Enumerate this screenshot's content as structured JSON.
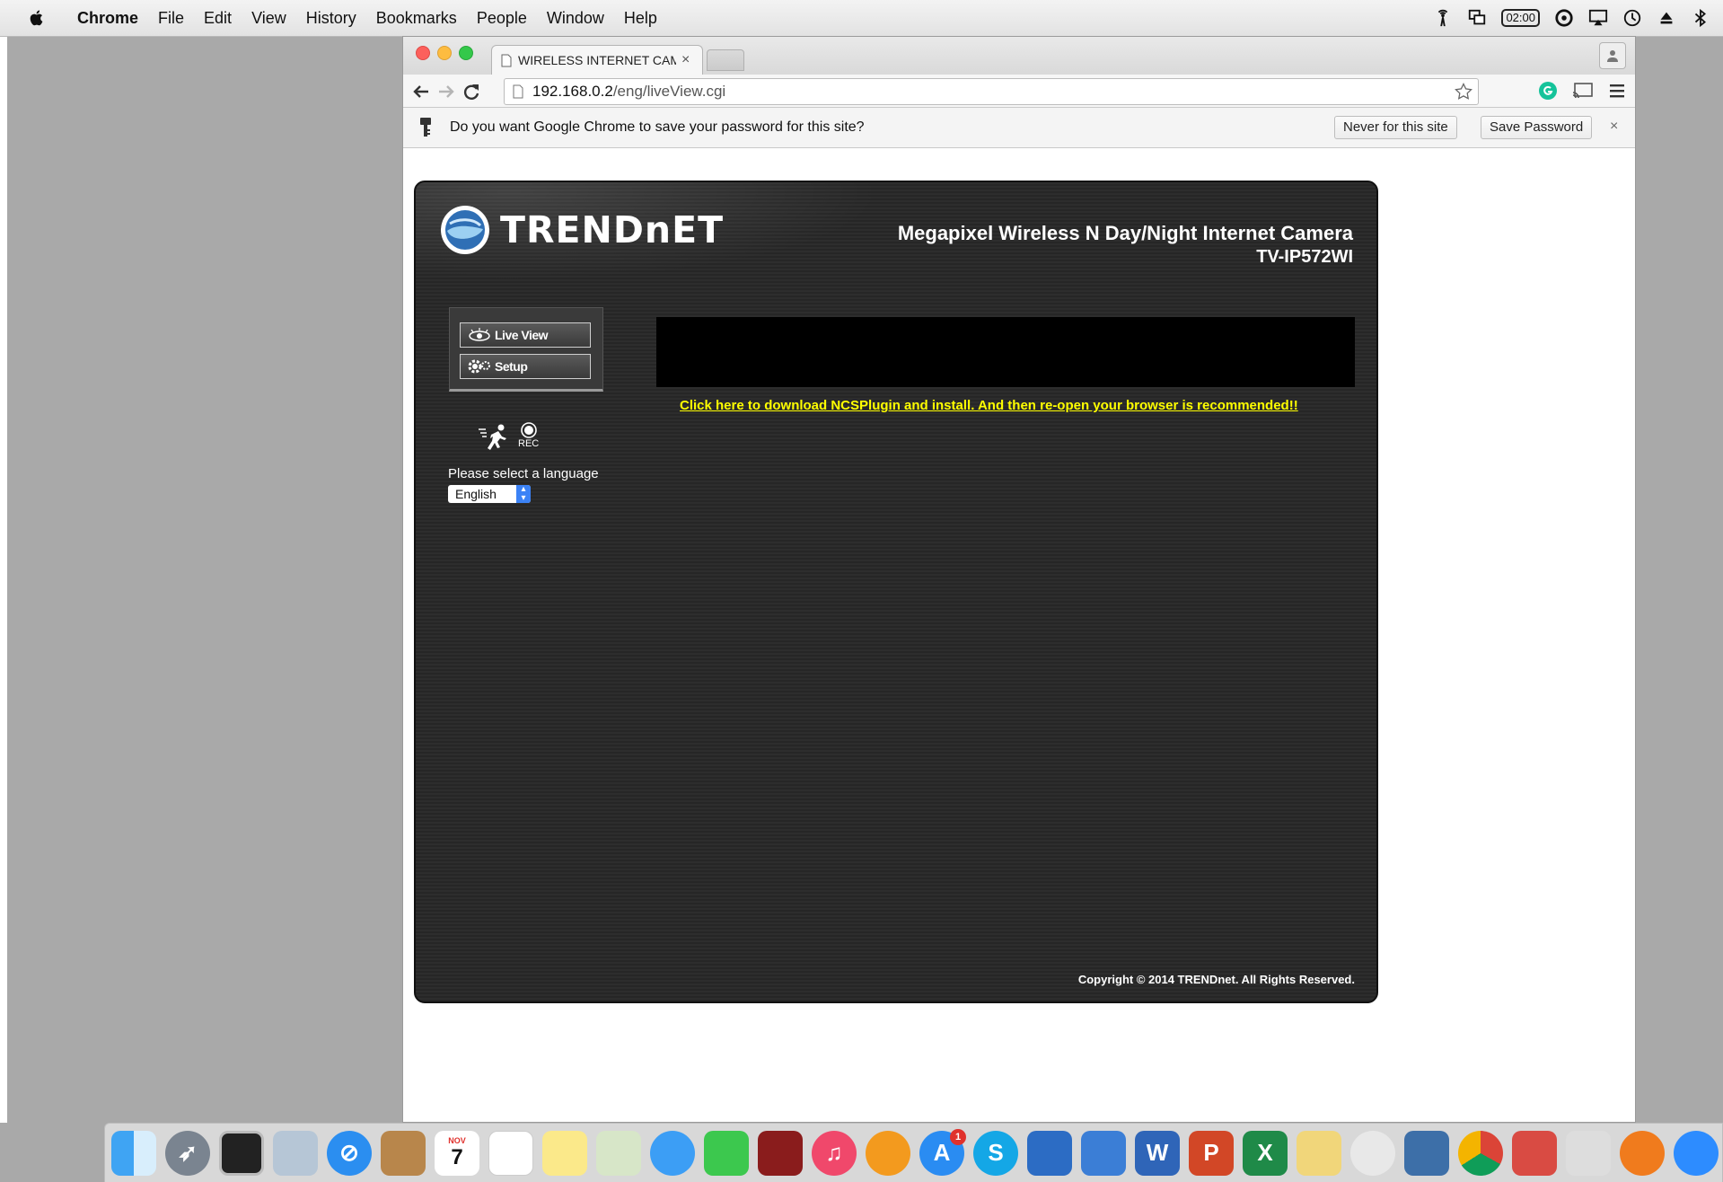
{
  "menubar": {
    "items": [
      "Chrome",
      "File",
      "Edit",
      "View",
      "History",
      "Bookmarks",
      "People",
      "Window",
      "Help"
    ],
    "clock": "02:00"
  },
  "browser": {
    "tab_title": "WIRELESS INTERNET CAMERA",
    "tab_close": "×",
    "url_host": "192.168.0.2",
    "url_path": "/eng/liveView.cgi",
    "infobar": {
      "message": "Do you want Google Chrome to save your password for this site?",
      "never_label": "Never for this site",
      "save_label": "Save Password",
      "close": "×"
    }
  },
  "camera": {
    "brand": "TRENDnET",
    "title": "Megapixel Wireless N Day/Night Internet Camera",
    "model": "TV-IP572WI",
    "nav": [
      {
        "label": "Live View",
        "icon": "eye-icon"
      },
      {
        "label": "Setup",
        "icon": "gear-icon"
      }
    ],
    "rec_label": "REC",
    "language_prompt": "Please select a language",
    "language_selected": "English",
    "plugin_link": "Click here to download NCSPlugin and install. And then re-open your browser is recommended!!",
    "copyright": "Copyright © 2014 TRENDnet. All Rights Reserved."
  },
  "dock": {
    "appstore_badge": "1",
    "calendar_month": "NOV",
    "calendar_day": "7"
  },
  "colors": {
    "link_yellow": "#ffff00",
    "cam_bg": "#2a2a2a"
  }
}
